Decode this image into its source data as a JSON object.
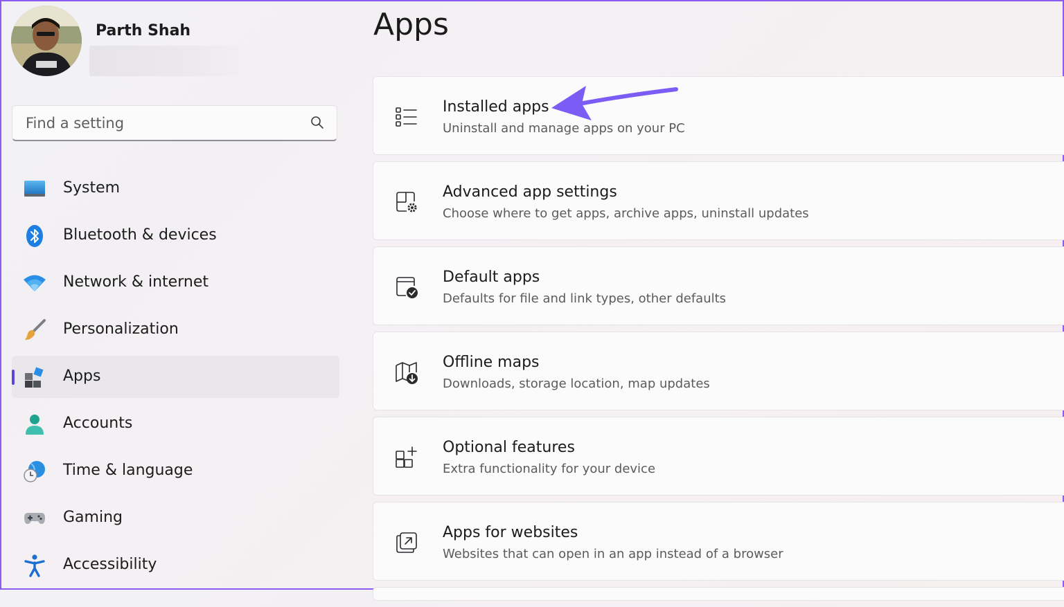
{
  "user": {
    "name": "Parth Shah"
  },
  "search": {
    "placeholder": "Find a setting"
  },
  "sidebar": {
    "items": [
      {
        "label": "System",
        "icon": "monitor-icon"
      },
      {
        "label": "Bluetooth & devices",
        "icon": "bluetooth-icon"
      },
      {
        "label": "Network & internet",
        "icon": "wifi-icon"
      },
      {
        "label": "Personalization",
        "icon": "brush-icon"
      },
      {
        "label": "Apps",
        "icon": "apps-icon",
        "selected": true
      },
      {
        "label": "Accounts",
        "icon": "person-icon"
      },
      {
        "label": "Time & language",
        "icon": "globe-clock-icon"
      },
      {
        "label": "Gaming",
        "icon": "gamepad-icon"
      },
      {
        "label": "Accessibility",
        "icon": "accessibility-icon"
      }
    ]
  },
  "page": {
    "title": "Apps"
  },
  "cards": [
    {
      "title": "Installed apps",
      "desc": "Uninstall and manage apps on your PC",
      "icon": "list-icon"
    },
    {
      "title": "Advanced app settings",
      "desc": "Choose where to get apps, archive apps, uninstall updates",
      "icon": "app-settings-icon"
    },
    {
      "title": "Default apps",
      "desc": "Defaults for file and link types, other defaults",
      "icon": "default-apps-icon"
    },
    {
      "title": "Offline maps",
      "desc": "Downloads, storage location, map updates",
      "icon": "map-download-icon"
    },
    {
      "title": "Optional features",
      "desc": "Extra functionality for your device",
      "icon": "grid-add-icon"
    },
    {
      "title": "Apps for websites",
      "desc": "Websites that can open in an app instead of a browser",
      "icon": "open-in-app-icon"
    }
  ],
  "colors": {
    "accent": "#5b46d6",
    "annotation_arrow": "#7b5cf5",
    "frame_border": "#8a5cf0"
  }
}
